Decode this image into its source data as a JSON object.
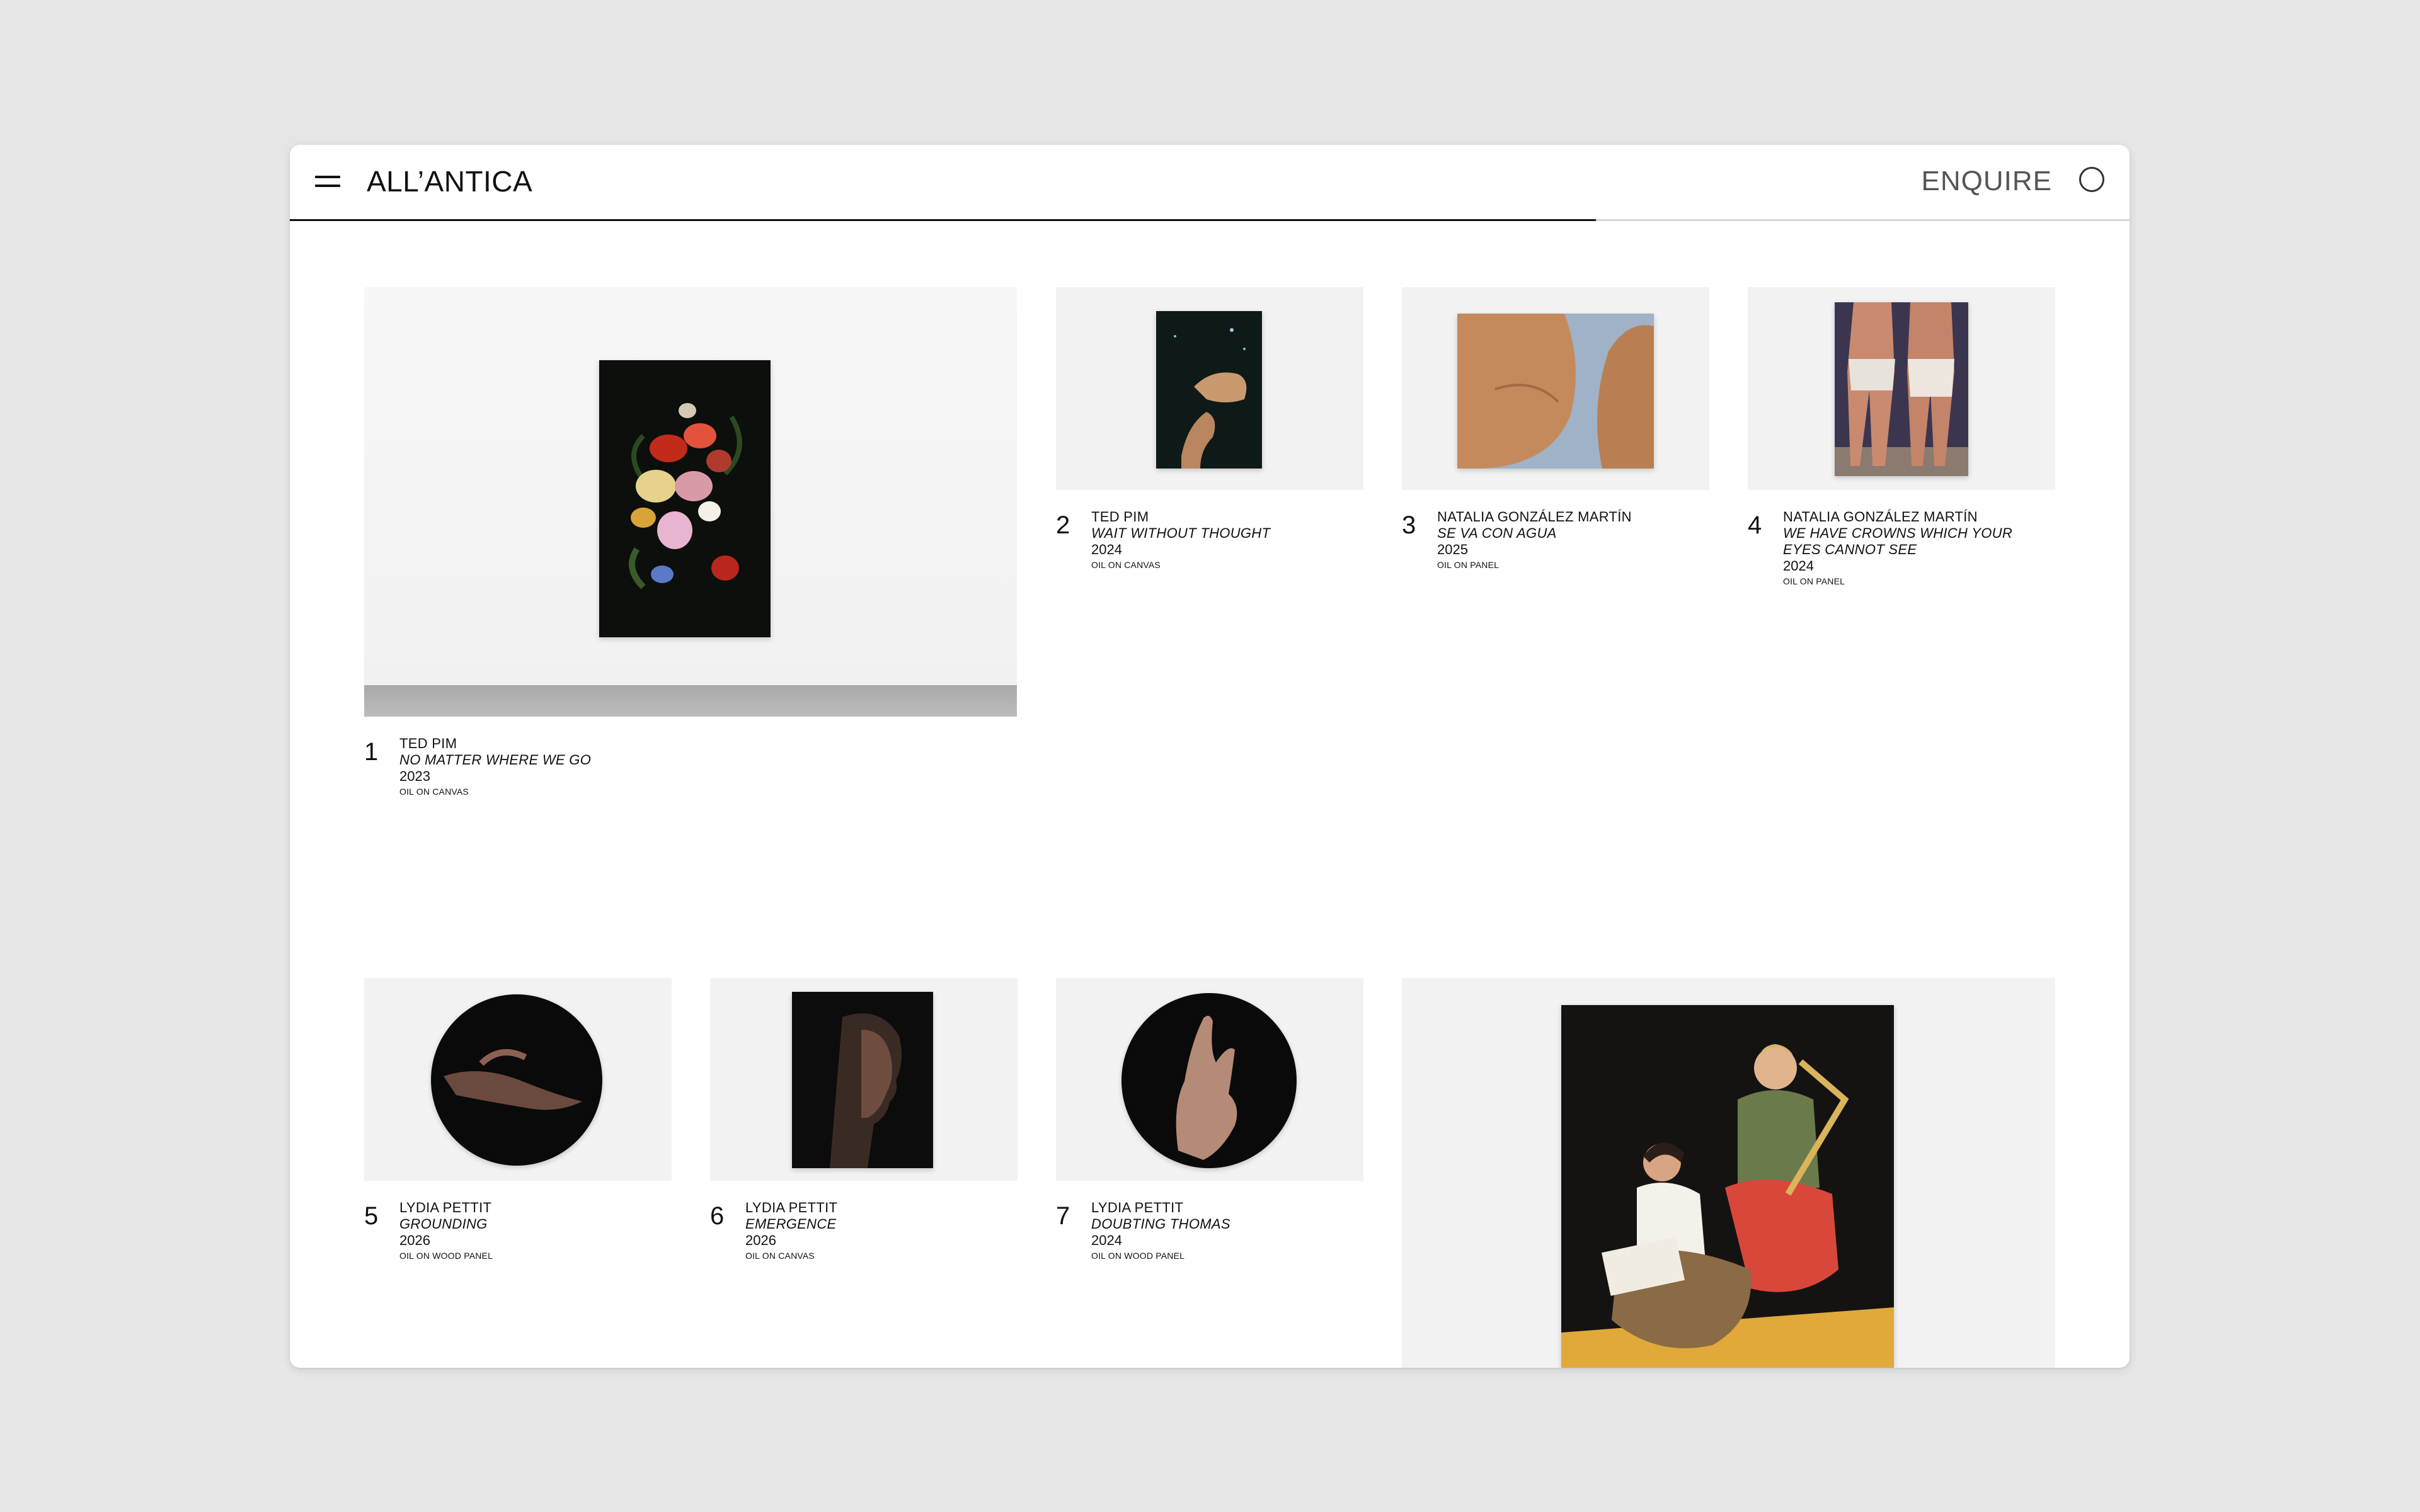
{
  "header": {
    "logo": "ALL’ANTICA",
    "enquire_label": "ENQUIRE",
    "progress": 0.71
  },
  "artworks": [
    {
      "number": "1",
      "artist": "TED PIM",
      "title": "NO MATTER WHERE WE GO",
      "year": "2023",
      "medium": "OIL ON CANVAS"
    },
    {
      "number": "2",
      "artist": "TED PIM",
      "title": "WAIT WITHOUT THOUGHT",
      "year": "2024",
      "medium": "OIL ON CANVAS"
    },
    {
      "number": "3",
      "artist": "NATALIA GONZÁLEZ MARTÍN",
      "title": "SE VA CON AGUA",
      "year": "2025",
      "medium": "OIL ON PANEL"
    },
    {
      "number": "4",
      "artist": "NATALIA GONZÁLEZ MARTÍN",
      "title": "WE HAVE CROWNS WHICH YOUR EYES CANNOT SEE",
      "year": "2024",
      "medium": "OIL ON PANEL"
    },
    {
      "number": "5",
      "artist": "LYDIA PETTIT",
      "title": "GROUNDING",
      "year": "2026",
      "medium": "OIL ON WOOD PANEL"
    },
    {
      "number": "6",
      "artist": "LYDIA PETTIT",
      "title": "EMERGENCE",
      "year": "2026",
      "medium": "OIL ON CANVAS"
    },
    {
      "number": "7",
      "artist": "LYDIA PETTIT",
      "title": "DOUBTING THOMAS",
      "year": "2024",
      "medium": "OIL ON WOOD PANEL"
    }
  ],
  "colors": {
    "background": "#e6e6e6",
    "window": "#ffffff",
    "text": "#111111",
    "progress": "#111111"
  }
}
